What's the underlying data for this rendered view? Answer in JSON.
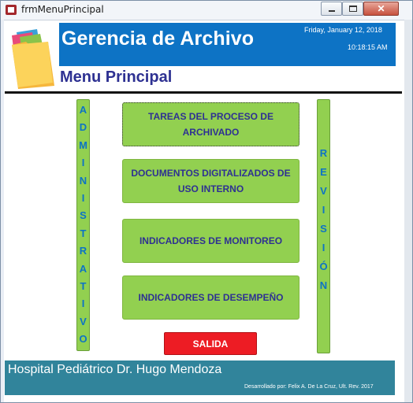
{
  "window": {
    "title": "frmMenuPrincipal",
    "close_symbol": "✕",
    "icons": [
      "access-app-icon",
      "minimize-icon",
      "maximize-icon",
      "close-icon"
    ]
  },
  "header": {
    "app_title": "Gerencia de Archivo",
    "date": "Friday, January 12, 2018",
    "time": "10:18:15 AM",
    "logo_icon": "folders-icon",
    "band_color": "#0d73c5"
  },
  "menu_title": "Menu Principal",
  "side_bars": {
    "left_letters": [
      "A",
      "D",
      "M",
      "I",
      "N",
      "I",
      "S",
      "T",
      "R",
      "A",
      "T",
      "I",
      "V",
      "O"
    ],
    "right_letters": [
      "R",
      "E",
      "V",
      "I",
      "S",
      "I",
      "Ó",
      "N"
    ],
    "color": "#92d050"
  },
  "buttons": [
    {
      "label": "TAREAS DEL PROCESO DE ARCHIVADO"
    },
    {
      "label": "DOCUMENTOS DIGITALIZADOS DE USO INTERNO"
    },
    {
      "label": "INDICADORES DE MONITOREO"
    },
    {
      "label": "INDICADORES DE DESEMPEÑO"
    }
  ],
  "exit_button": {
    "label": "SALIDA",
    "color": "#ed1c24"
  },
  "footer": {
    "hospital": "Hospital Pediátrico Dr. Hugo Mendoza",
    "credit": "Desarrollado por:  Felix A. De La Cruz, Ult. Rev. 2017",
    "color": "#31849b"
  },
  "colors": {
    "title_blue": "#2e3192",
    "letter_blue": "#0d73c5"
  }
}
